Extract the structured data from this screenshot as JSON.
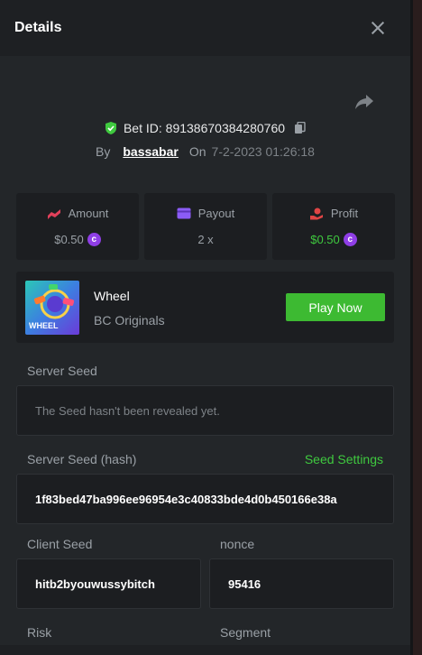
{
  "header": {
    "title": "Details"
  },
  "bet": {
    "id_label": "Bet ID: 89138670384280760",
    "by_label": "By",
    "user": "bassabar",
    "on_label": "On",
    "date": "7-2-2023 01:26:18"
  },
  "stats": {
    "amount": {
      "label": "Amount",
      "value": "$0.50"
    },
    "payout": {
      "label": "Payout",
      "value": "2 x"
    },
    "profit": {
      "label": "Profit",
      "value": "$0.50"
    },
    "coin_symbol": "c"
  },
  "game": {
    "name": "Wheel",
    "provider": "BC Originals",
    "play_label": "Play Now",
    "thumb_label": "WHEEL"
  },
  "seeds": {
    "server_seed_label": "Server Seed",
    "server_seed_value": "The Seed hasn't been revealed yet.",
    "server_hash_label": "Server Seed (hash)",
    "seed_settings_label": "Seed Settings",
    "server_hash_value": "1f83bed47ba996ee96954e3c40833bde4d0b450166e38a",
    "client_seed_label": "Client Seed",
    "client_seed_value": "hitb2byouwussybitch",
    "nonce_label": "nonce",
    "nonce_value": "95416",
    "risk_label": "Risk",
    "segment_label": "Segment"
  },
  "colors": {
    "accent_green": "#3dba32",
    "amount_red": "#e0405a",
    "payout_purple": "#8b5cf6",
    "profit_red": "#e04545",
    "coin_purple": "#8f3ee6"
  }
}
